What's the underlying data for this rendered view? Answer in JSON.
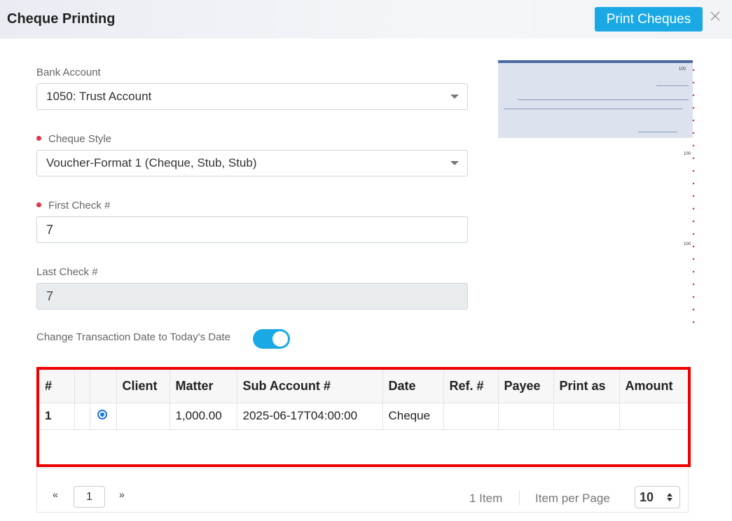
{
  "header": {
    "title": "Cheque Printing",
    "print_label": "Print Cheques"
  },
  "form": {
    "bank_account": {
      "label": "Bank Account",
      "value": "1050: Trust Account"
    },
    "cheque_style": {
      "label": "Cheque Style",
      "value": "Voucher-Format 1 (Cheque, Stub, Stub)"
    },
    "first_check": {
      "label": "First Check #",
      "value": "7"
    },
    "last_check": {
      "label": "Last Check #",
      "value": "7"
    },
    "change_date": {
      "label": "Change Transaction Date to Today's Date",
      "on": true
    }
  },
  "preview": {
    "cheque_no": "100",
    "stub1_no": "100",
    "stub2_no": "100"
  },
  "table": {
    "headers": [
      "#",
      "",
      "",
      "Client",
      "Matter",
      "Sub Account #",
      "Date",
      "Ref. #",
      "Payee",
      "Print as",
      "Amount"
    ],
    "rows": [
      {
        "num": "1",
        "selected": true,
        "client": "",
        "matter": "1,000.00",
        "sub_account": "2025-06-17T04:00:00",
        "date": "Cheque",
        "ref": "",
        "payee": "",
        "print_as": "",
        "amount": ""
      }
    ]
  },
  "pager": {
    "prev": "«",
    "page": "1",
    "next": "»",
    "count": "1 Item",
    "ipp_label": "Item per Page",
    "ipp_value": "10"
  },
  "colors": {
    "accent": "#1aa9e5",
    "required": "#e0354a",
    "highlight": "#ee0000"
  }
}
